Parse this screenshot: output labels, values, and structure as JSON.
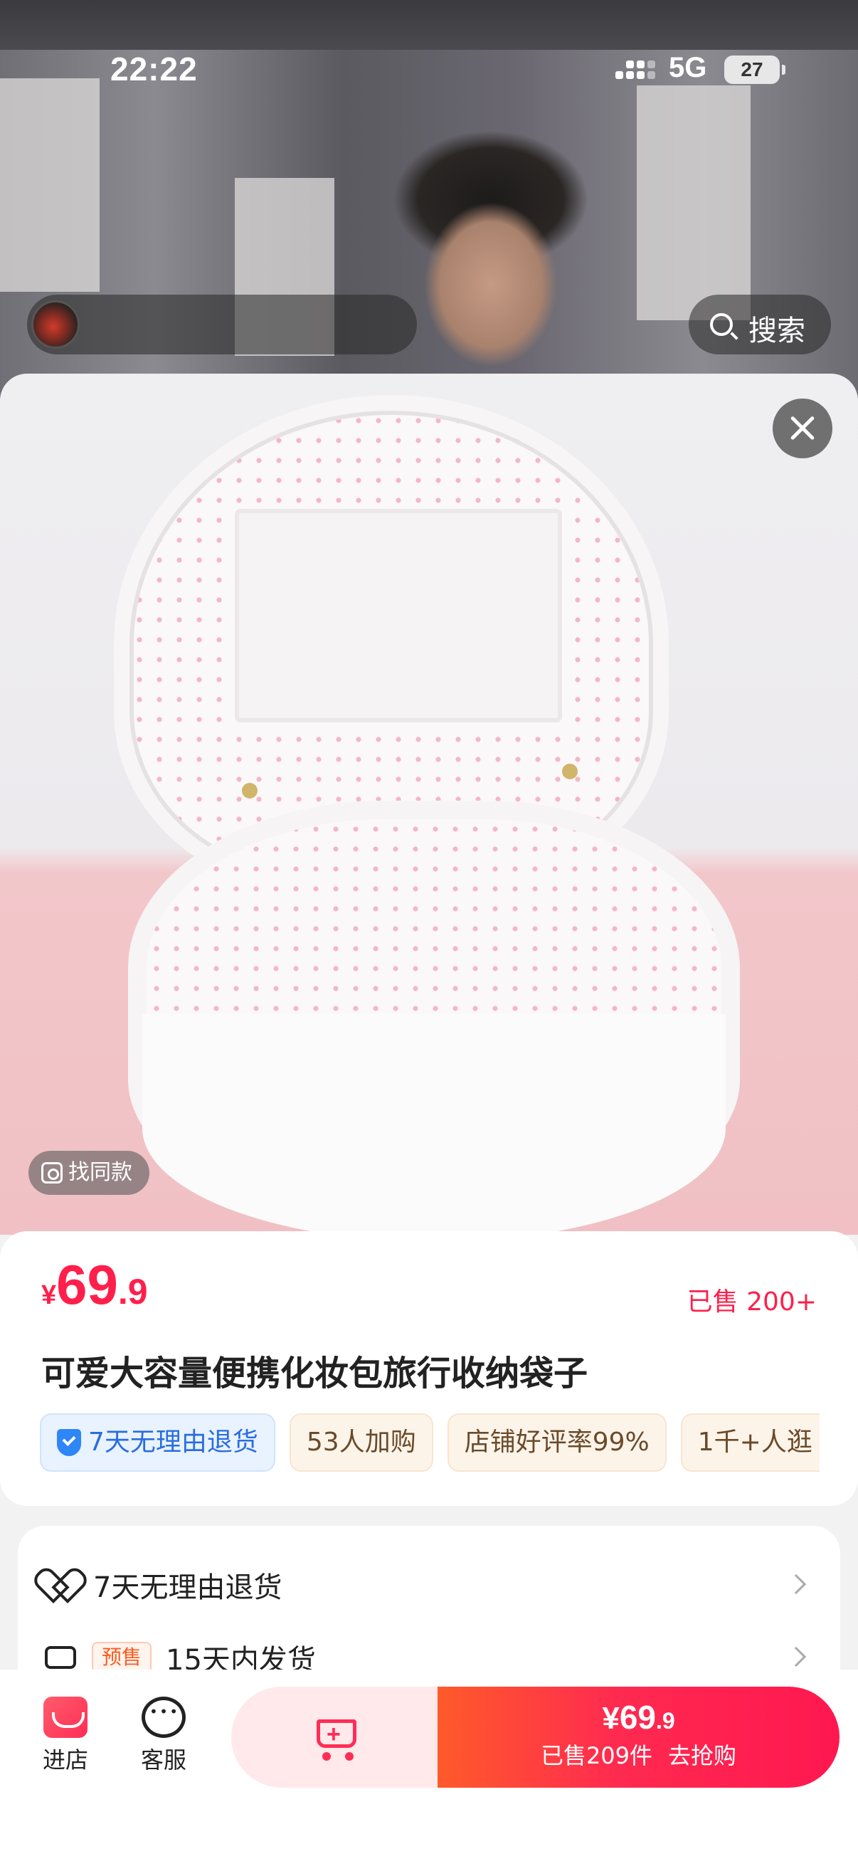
{
  "status_bar": {
    "time": "22:22",
    "network": "5G",
    "battery": "27"
  },
  "header": {
    "search_label": "搜索"
  },
  "product": {
    "find_similar": "找同款",
    "price_currency": "¥",
    "price_integer": "69",
    "price_decimal": ".9",
    "sold": "已售 200+",
    "title": "可爱大容量便携化妆包旅行收纳袋子",
    "tags": [
      "7天无理由退货",
      "53人加购",
      "店铺好评率99%",
      "1千+人逛"
    ]
  },
  "services": [
    {
      "label": "7天无理由退货",
      "icon": "heart-shield-icon"
    },
    {
      "badge": "预售",
      "label": "15天内发货",
      "icon": "truck-icon"
    }
  ],
  "bottom_bar": {
    "store_label": "进店",
    "service_label": "客服",
    "buy_price_currency": "¥",
    "buy_price_integer": "69",
    "buy_price_decimal": ".9",
    "buy_sold": "已售209件",
    "buy_action": "去抢购"
  },
  "colors": {
    "accent": "#ff1f4b",
    "tag_blue": "#2a6de0",
    "tag_brown": "#6b4a2a"
  }
}
